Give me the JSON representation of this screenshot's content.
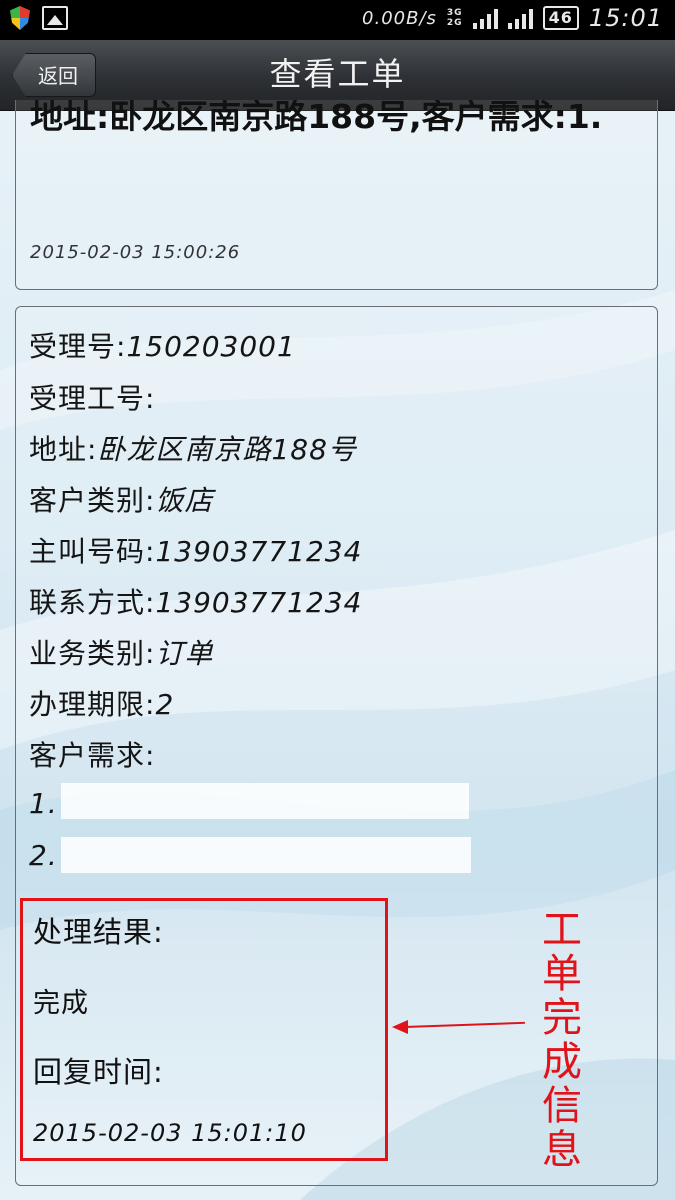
{
  "status_bar": {
    "net_speed": "0.00B/s",
    "network_top": "3G",
    "network_bottom": "2G",
    "battery": "46",
    "time": "15:01"
  },
  "header": {
    "back_label": "返回",
    "title": "查看工单"
  },
  "previous_card": {
    "text": "地址:卧龙区南京路188号,客户需求:1.",
    "timestamp": "2015-02-03  15:00:26"
  },
  "detail": {
    "rows": [
      {
        "label": "受理号:",
        "value": "150203001"
      },
      {
        "label": "受理工号:",
        "value": ""
      },
      {
        "label": "地址:",
        "value": "卧龙区南京路188号"
      },
      {
        "label": "客户类别:",
        "value": "饭店"
      },
      {
        "label": "主叫号码:",
        "value": "13903771234"
      },
      {
        "label": "联系方式:",
        "value": "13903771234"
      },
      {
        "label": "业务类别:",
        "value": "订单"
      },
      {
        "label": "办理期限:",
        "value": "2"
      },
      {
        "label": "客户需求:",
        "value": ""
      }
    ],
    "needs": [
      "1.",
      "2."
    ],
    "result_label": "处理结果:",
    "result_value": "完成",
    "reply_label": "回复时间:",
    "reply_time": "2015-02-03  15:01:10"
  },
  "annotation": {
    "text": "工单完成信息",
    "color": "#e0121a"
  }
}
